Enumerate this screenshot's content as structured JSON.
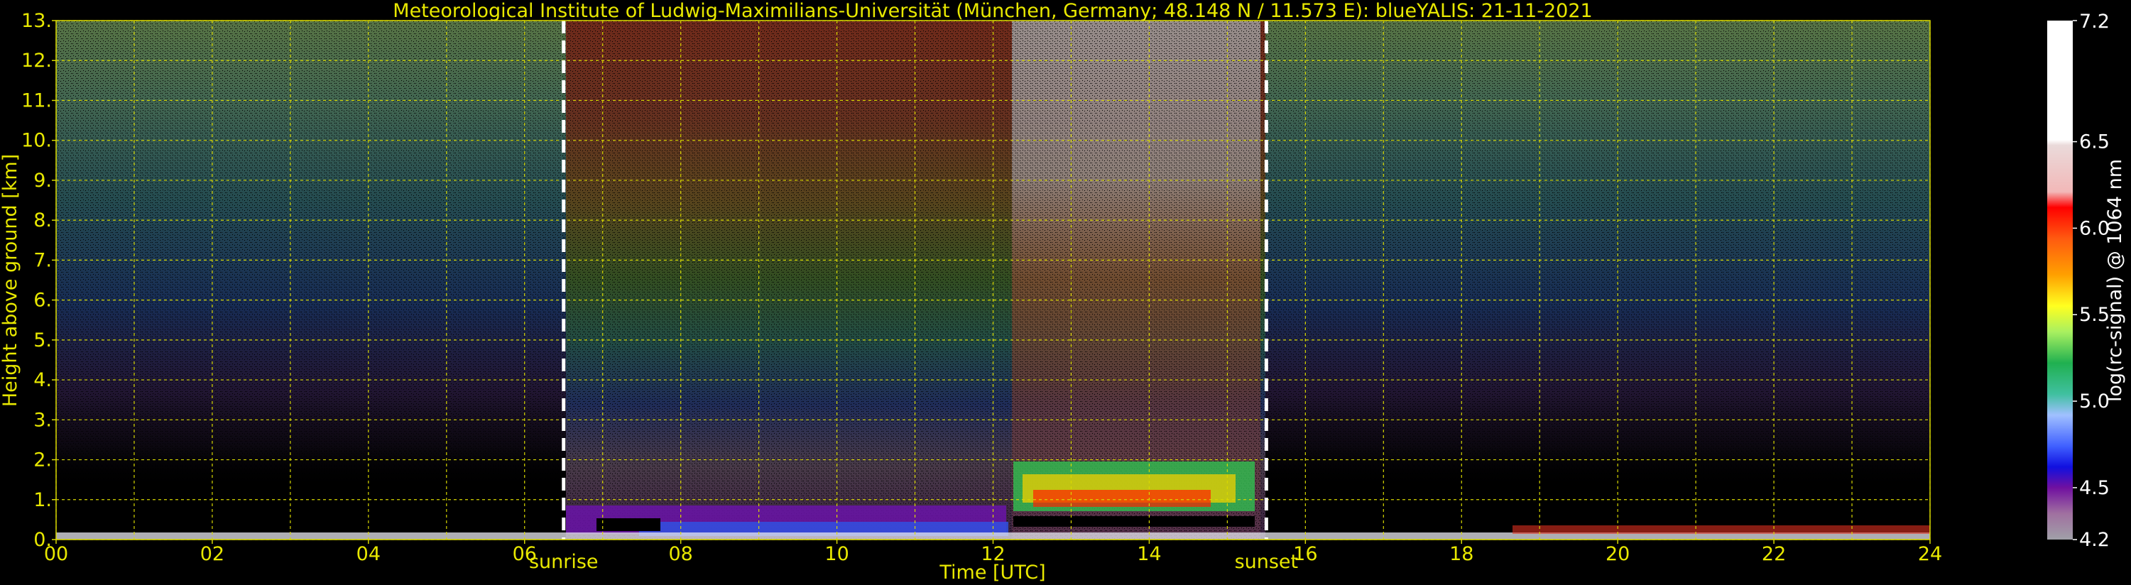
{
  "chart_data": {
    "type": "heatmap",
    "title": "Meteorological Institute of Ludwig-Maximilians-Universität (München, Germany; 48.148 N / 11.573 E):    blueYALIS: 21-11-2021",
    "xlabel": "Time [UTC]",
    "ylabel": "Height above ground [km]",
    "xlim": [
      0,
      24
    ],
    "ylim": [
      0,
      13
    ],
    "x_ticks": [
      "00",
      "02",
      "04",
      "06",
      "08",
      "10",
      "12",
      "14",
      "16",
      "18",
      "20",
      "22",
      "24"
    ],
    "y_ticks": [
      "0.",
      "1.",
      "2.",
      "3.",
      "4.",
      "5.",
      "6.",
      "7.",
      "8.",
      "9.",
      "10.",
      "11.",
      "12.",
      "13."
    ],
    "grid": true,
    "events": [
      {
        "label": "sunrise",
        "x": 6.5
      },
      {
        "label": "sunset",
        "x": 15.5
      }
    ],
    "colorbar": {
      "label": "log(rc-signal) @ 1064 nm",
      "range": [
        4.2,
        7.2
      ],
      "ticks": [
        "7.2",
        "6.5",
        "6.0",
        "5.5",
        "5.0",
        "4.5",
        "4.2"
      ],
      "tick_values": [
        7.2,
        6.5,
        6.0,
        5.5,
        5.0,
        4.5,
        4.2
      ]
    }
  },
  "colors": {
    "axis_text": "#e8e800",
    "grid": "#d8d800",
    "event_line": "#ffffff",
    "background": "#000000"
  }
}
